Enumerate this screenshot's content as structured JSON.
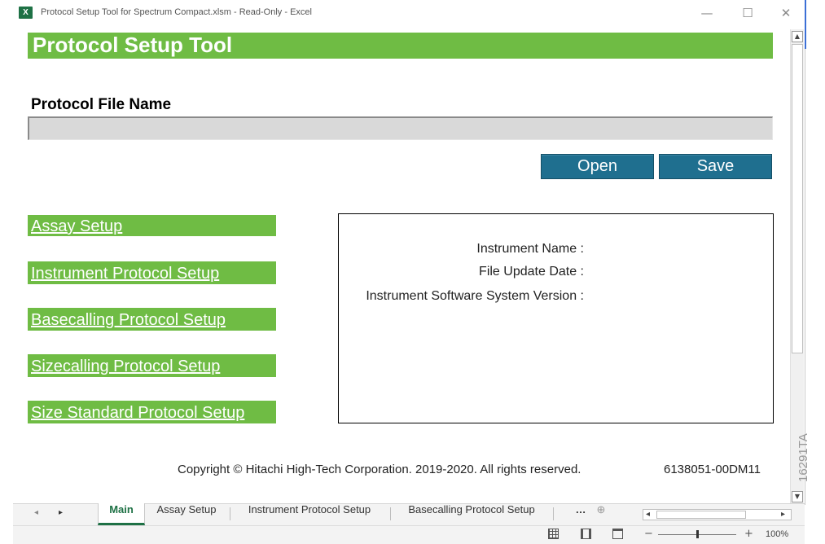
{
  "window": {
    "app_icon": "excel-icon",
    "title": "Protocol Setup Tool for Spectrum Compact.xlsm  -  Read-Only  -  Excel",
    "minimize": "—",
    "maximize": "☐",
    "close": "✕"
  },
  "sheet": {
    "banner_title": "Protocol Setup Tool",
    "file_name_label": "Protocol File Name",
    "file_name_value": "",
    "open_label": "Open",
    "save_label": "Save",
    "nav_links": [
      "Assay Setup",
      "Instrument Protocol Setup",
      "Basecalling Protocol Setup",
      "Sizecalling Protocol Setup",
      "Size Standard Protocol Setup"
    ],
    "info": {
      "instrument_name_label": "Instrument Name :",
      "file_update_date_label": "File Update Date :",
      "software_version_label": "Instrument Software System Version :"
    },
    "copyright": "Copyright © Hitachi High-Tech Corporation. 2019-2020. All rights reserved.",
    "document_id": "6138051-00DM11"
  },
  "tabs": {
    "prev_arrow": "◂",
    "next_arrow": "▸",
    "items": [
      "Main",
      "Assay Setup",
      "Instrument Protocol Setup",
      "Basecalling Protocol Setup"
    ],
    "active": "Main",
    "more": "…",
    "add_sheet": "⊕"
  },
  "statusbar": {
    "zoom_minus": "−",
    "zoom_plus": "+",
    "zoom_level": "100%",
    "zoom_fraction": 0.5
  },
  "figure_code": "16291TA",
  "colors": {
    "banner_green": "#6fbc44",
    "button_blue": "#1f6f8f",
    "excel_green": "#1e7145"
  }
}
